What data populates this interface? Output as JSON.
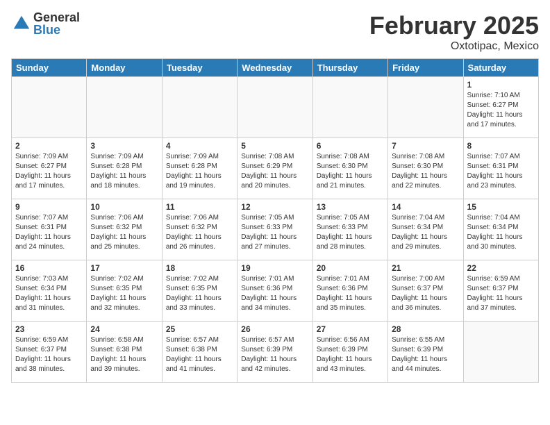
{
  "logo": {
    "general": "General",
    "blue": "Blue"
  },
  "header": {
    "month": "February 2025",
    "location": "Oxtotipac, Mexico"
  },
  "weekdays": [
    "Sunday",
    "Monday",
    "Tuesday",
    "Wednesday",
    "Thursday",
    "Friday",
    "Saturday"
  ],
  "weeks": [
    [
      {
        "day": "",
        "info": ""
      },
      {
        "day": "",
        "info": ""
      },
      {
        "day": "",
        "info": ""
      },
      {
        "day": "",
        "info": ""
      },
      {
        "day": "",
        "info": ""
      },
      {
        "day": "",
        "info": ""
      },
      {
        "day": "1",
        "info": "Sunrise: 7:10 AM\nSunset: 6:27 PM\nDaylight: 11 hours\nand 17 minutes."
      }
    ],
    [
      {
        "day": "2",
        "info": "Sunrise: 7:09 AM\nSunset: 6:27 PM\nDaylight: 11 hours\nand 17 minutes."
      },
      {
        "day": "3",
        "info": "Sunrise: 7:09 AM\nSunset: 6:28 PM\nDaylight: 11 hours\nand 18 minutes."
      },
      {
        "day": "4",
        "info": "Sunrise: 7:09 AM\nSunset: 6:28 PM\nDaylight: 11 hours\nand 19 minutes."
      },
      {
        "day": "5",
        "info": "Sunrise: 7:08 AM\nSunset: 6:29 PM\nDaylight: 11 hours\nand 20 minutes."
      },
      {
        "day": "6",
        "info": "Sunrise: 7:08 AM\nSunset: 6:30 PM\nDaylight: 11 hours\nand 21 minutes."
      },
      {
        "day": "7",
        "info": "Sunrise: 7:08 AM\nSunset: 6:30 PM\nDaylight: 11 hours\nand 22 minutes."
      },
      {
        "day": "8",
        "info": "Sunrise: 7:07 AM\nSunset: 6:31 PM\nDaylight: 11 hours\nand 23 minutes."
      }
    ],
    [
      {
        "day": "9",
        "info": "Sunrise: 7:07 AM\nSunset: 6:31 PM\nDaylight: 11 hours\nand 24 minutes."
      },
      {
        "day": "10",
        "info": "Sunrise: 7:06 AM\nSunset: 6:32 PM\nDaylight: 11 hours\nand 25 minutes."
      },
      {
        "day": "11",
        "info": "Sunrise: 7:06 AM\nSunset: 6:32 PM\nDaylight: 11 hours\nand 26 minutes."
      },
      {
        "day": "12",
        "info": "Sunrise: 7:05 AM\nSunset: 6:33 PM\nDaylight: 11 hours\nand 27 minutes."
      },
      {
        "day": "13",
        "info": "Sunrise: 7:05 AM\nSunset: 6:33 PM\nDaylight: 11 hours\nand 28 minutes."
      },
      {
        "day": "14",
        "info": "Sunrise: 7:04 AM\nSunset: 6:34 PM\nDaylight: 11 hours\nand 29 minutes."
      },
      {
        "day": "15",
        "info": "Sunrise: 7:04 AM\nSunset: 6:34 PM\nDaylight: 11 hours\nand 30 minutes."
      }
    ],
    [
      {
        "day": "16",
        "info": "Sunrise: 7:03 AM\nSunset: 6:34 PM\nDaylight: 11 hours\nand 31 minutes."
      },
      {
        "day": "17",
        "info": "Sunrise: 7:02 AM\nSunset: 6:35 PM\nDaylight: 11 hours\nand 32 minutes."
      },
      {
        "day": "18",
        "info": "Sunrise: 7:02 AM\nSunset: 6:35 PM\nDaylight: 11 hours\nand 33 minutes."
      },
      {
        "day": "19",
        "info": "Sunrise: 7:01 AM\nSunset: 6:36 PM\nDaylight: 11 hours\nand 34 minutes."
      },
      {
        "day": "20",
        "info": "Sunrise: 7:01 AM\nSunset: 6:36 PM\nDaylight: 11 hours\nand 35 minutes."
      },
      {
        "day": "21",
        "info": "Sunrise: 7:00 AM\nSunset: 6:37 PM\nDaylight: 11 hours\nand 36 minutes."
      },
      {
        "day": "22",
        "info": "Sunrise: 6:59 AM\nSunset: 6:37 PM\nDaylight: 11 hours\nand 37 minutes."
      }
    ],
    [
      {
        "day": "23",
        "info": "Sunrise: 6:59 AM\nSunset: 6:37 PM\nDaylight: 11 hours\nand 38 minutes."
      },
      {
        "day": "24",
        "info": "Sunrise: 6:58 AM\nSunset: 6:38 PM\nDaylight: 11 hours\nand 39 minutes."
      },
      {
        "day": "25",
        "info": "Sunrise: 6:57 AM\nSunset: 6:38 PM\nDaylight: 11 hours\nand 41 minutes."
      },
      {
        "day": "26",
        "info": "Sunrise: 6:57 AM\nSunset: 6:39 PM\nDaylight: 11 hours\nand 42 minutes."
      },
      {
        "day": "27",
        "info": "Sunrise: 6:56 AM\nSunset: 6:39 PM\nDaylight: 11 hours\nand 43 minutes."
      },
      {
        "day": "28",
        "info": "Sunrise: 6:55 AM\nSunset: 6:39 PM\nDaylight: 11 hours\nand 44 minutes."
      },
      {
        "day": "",
        "info": ""
      }
    ]
  ]
}
